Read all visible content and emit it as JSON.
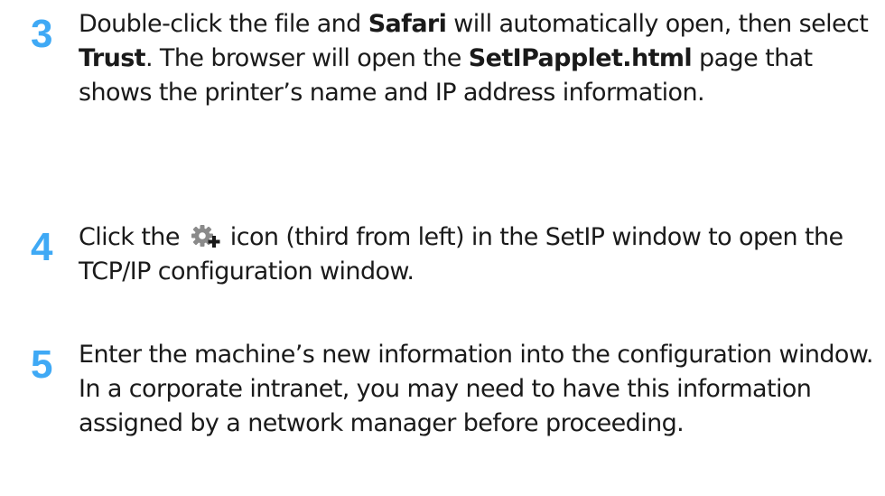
{
  "steps": [
    {
      "number": "3",
      "parts": [
        {
          "text": "Double-click the file and ",
          "bold": false
        },
        {
          "text": "Safari",
          "bold": true
        },
        {
          "text": " will automatically open, then select ",
          "bold": false
        },
        {
          "text": "Trust",
          "bold": true
        },
        {
          "text": ". The browser will open the ",
          "bold": false
        },
        {
          "text": "SetIPapplet.html",
          "bold": true
        },
        {
          "text": " page that shows the printer’s name and IP address information.",
          "bold": false
        }
      ]
    },
    {
      "number": "4",
      "before_icon": "Click the ",
      "icon": "gear-plus-icon",
      "after_icon": " icon (third from left) in the SetIP window to open the TCP/IP configuration window."
    },
    {
      "number": "5",
      "text": "Enter the machine’s new information into the configuration window. In a corporate intranet, you may need to have this information assigned by a network manager before proceeding."
    }
  ],
  "colors": {
    "step_number": "#3fa9f5",
    "body_text": "#1a1a1a",
    "icon_gear": "#8a8a8a",
    "icon_plus": "#1a1a1a"
  }
}
